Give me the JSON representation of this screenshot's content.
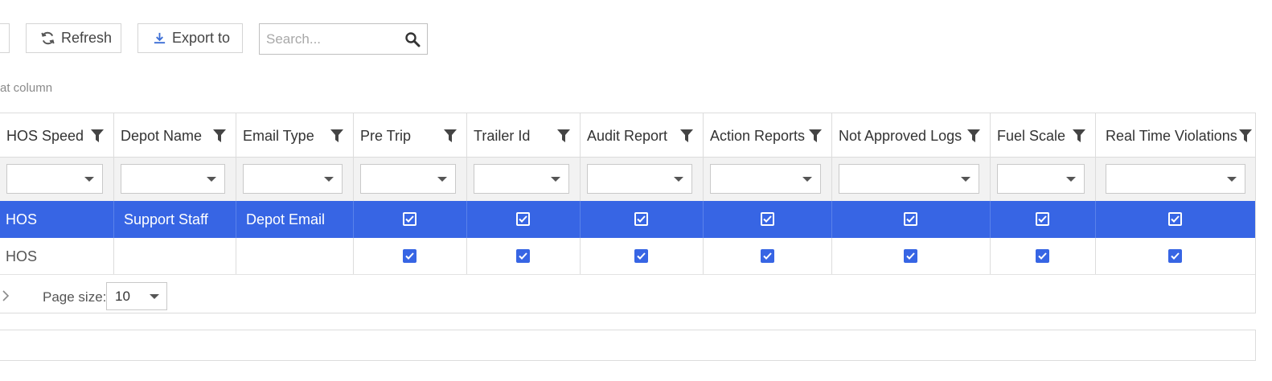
{
  "toolbar": {
    "refresh_label": "Refresh",
    "export_label": "Export to",
    "search_placeholder": "Search..."
  },
  "group_hint": "at column",
  "columns": [
    {
      "key": "hos_speed",
      "label": "HOS Speed"
    },
    {
      "key": "depot_name",
      "label": "Depot Name"
    },
    {
      "key": "email_type",
      "label": "Email Type"
    },
    {
      "key": "pre_trip",
      "label": "Pre Trip"
    },
    {
      "key": "trailer_id",
      "label": "Trailer Id"
    },
    {
      "key": "audit_report",
      "label": "Audit Report"
    },
    {
      "key": "action_reports",
      "label": "Action Reports"
    },
    {
      "key": "not_approved_logs",
      "label": "Not Approved Logs"
    },
    {
      "key": "fuel_scale",
      "label": "Fuel Scale"
    },
    {
      "key": "real_time_violations",
      "label": "Real Time Violations"
    }
  ],
  "rows": [
    {
      "selected": true,
      "hos_speed": "HOS",
      "depot_name": "Support Staff",
      "email_type": "Depot Email",
      "pre_trip": true,
      "trailer_id": true,
      "audit_report": true,
      "action_reports": true,
      "not_approved_logs": true,
      "fuel_scale": true,
      "real_time_violations": true
    },
    {
      "selected": false,
      "hos_speed": "HOS",
      "depot_name": "",
      "email_type": "",
      "pre_trip": true,
      "trailer_id": true,
      "audit_report": true,
      "action_reports": true,
      "not_approved_logs": true,
      "fuel_scale": true,
      "real_time_violations": true
    }
  ],
  "pager": {
    "page_size_label": "Page size:",
    "page_size_value": "10"
  },
  "colors": {
    "selected_row": "#3765e4",
    "checkbox": "#3765e4",
    "border": "#dcdcdc"
  }
}
